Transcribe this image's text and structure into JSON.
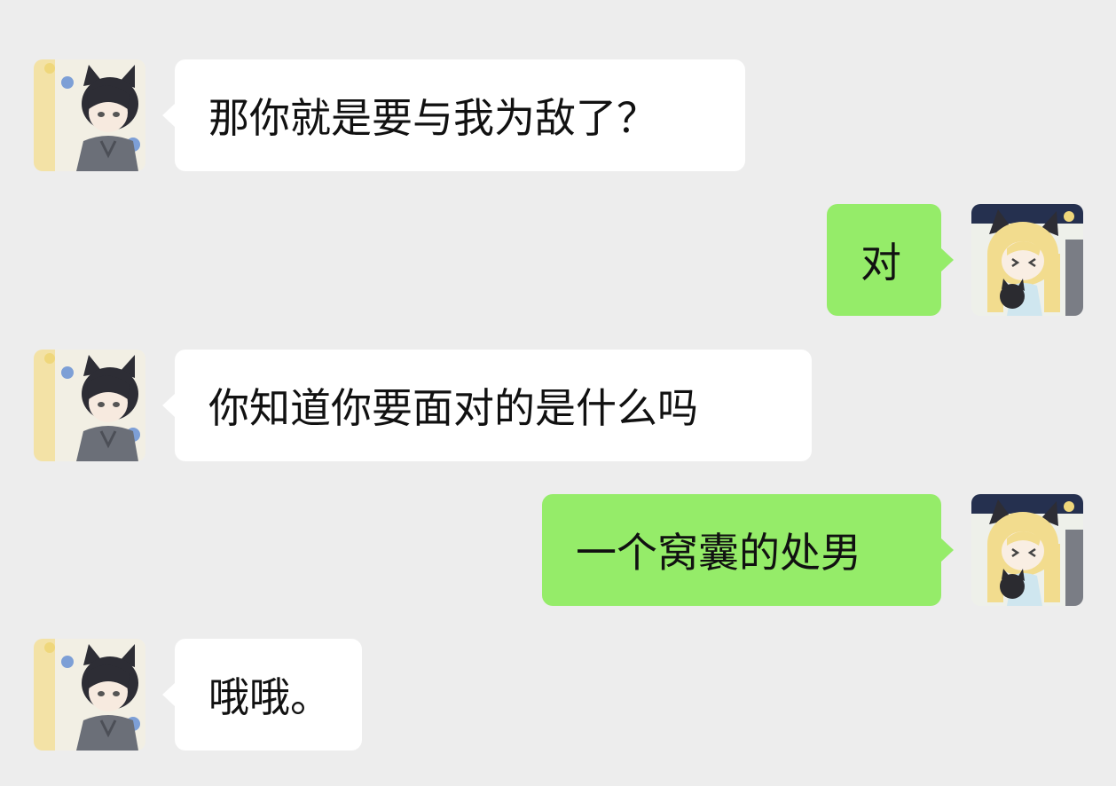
{
  "colors": {
    "background": "#ededed",
    "incoming_bubble": "#ffffff",
    "outgoing_bubble": "#95ec69",
    "text": "#111111"
  },
  "contact_avatar_icon": "dark-haired-cat-ear-girl-avatar-icon",
  "self_avatar_icon": "blonde-cat-ear-girl-avatar-icon",
  "messages": [
    {
      "side": "incoming",
      "text": "那你就是要与我为敌了？"
    },
    {
      "side": "outgoing",
      "text": "对"
    },
    {
      "side": "incoming",
      "text": "你知道你要面对的是什么吗"
    },
    {
      "side": "outgoing",
      "text": "一个窝囊的处男"
    },
    {
      "side": "incoming",
      "text": "哦哦。"
    }
  ]
}
